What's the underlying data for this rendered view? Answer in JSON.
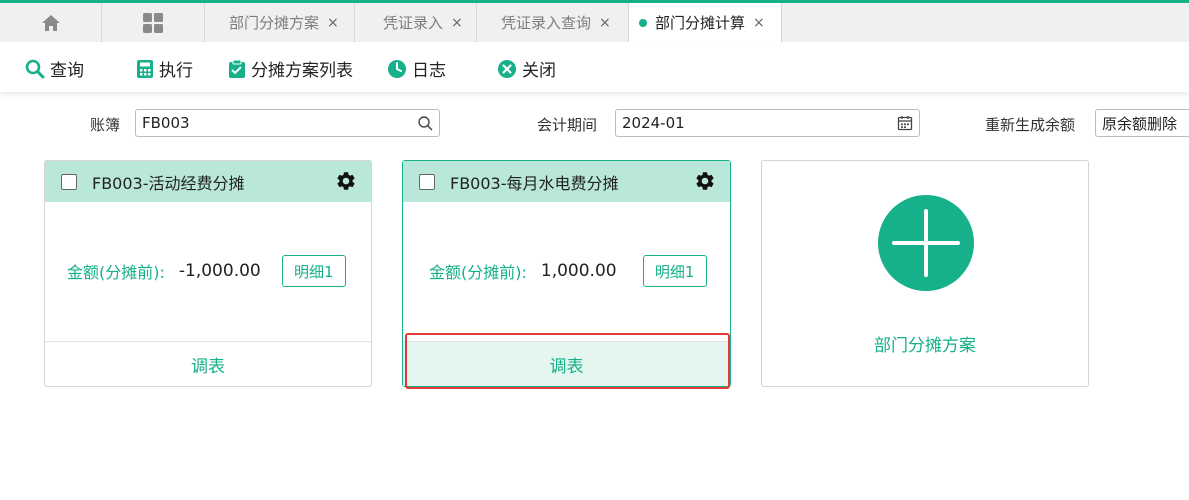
{
  "tabs": {
    "items": [
      {
        "label": "部门分摊方案"
      },
      {
        "label": "凭证录入"
      },
      {
        "label": "凭证录入查询"
      },
      {
        "label": "部门分摊计算"
      }
    ],
    "close_glyph": "×"
  },
  "toolbar": {
    "query_label": "查询",
    "execute_label": "执行",
    "plan_list_label": "分摊方案列表",
    "log_label": "日志",
    "close_label": "关闭"
  },
  "filters": {
    "ledger_label": "账簿",
    "ledger_value": "FB003",
    "period_label": "会计期间",
    "period_value": "2024-01",
    "regen_label": "重新生成余额",
    "regen_value": "原余额删除"
  },
  "cards": [
    {
      "title": "FB003-活动经费分摊",
      "amount_label": "金额(分摊前):",
      "amount_value": "-1,000.00",
      "detail_label": "明细1",
      "footer_label": "调表"
    },
    {
      "title": "FB003-每月水电费分摊",
      "amount_label": "金额(分摊前):",
      "amount_value": "1,000.00",
      "detail_label": "明细1",
      "footer_label": "调表"
    }
  ],
  "add_card": {
    "label": "部门分摊方案"
  },
  "colors": {
    "accent": "#16b08a",
    "card_header": "#b9e8da",
    "highlight": "#e53935"
  }
}
